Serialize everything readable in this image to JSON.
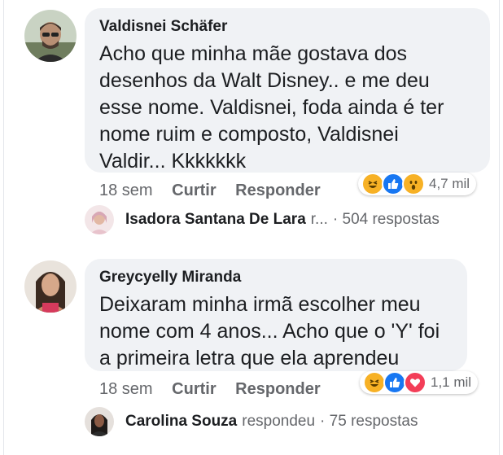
{
  "comments": [
    {
      "author": "Valdisnei Schäfer",
      "text_lines": [
        "Acho que minha mãe gostava dos",
        "desenhos da Walt Disney.. e me deu",
        "esse nome. Valdisnei, foda ainda é ter",
        "nome ruim e composto, Valdisnei",
        "Valdir... Kkkkkkk"
      ],
      "time": "18 sem",
      "like_label": "Curtir",
      "reply_label": "Responder",
      "reactions": [
        "haha-icon",
        "like-icon",
        "wow-icon"
      ],
      "reaction_count": "4,7 mil",
      "reply_summary": {
        "name": "Isadora Santana De Lara",
        "action": "r...",
        "count": "· 504 respostas"
      }
    },
    {
      "author": "Greycyelly Miranda",
      "text_lines": [
        "Deixaram minha irmã escolher meu",
        "nome com 4 anos... Acho que o 'Y' foi",
        "a primeira letra que ela aprendeu"
      ],
      "time": "18 sem",
      "like_label": "Curtir",
      "reply_label": "Responder",
      "reactions": [
        "haha-icon",
        "like-icon",
        "love-icon"
      ],
      "reaction_count": "1,1 mil",
      "reply_summary": {
        "name": "Carolina Souza",
        "action": "respondeu",
        "count": "· 75 respostas"
      }
    }
  ],
  "colors": {
    "bubble": "#f0f2f5",
    "secondary_text": "#65676b",
    "like_blue": "#1877f2",
    "haha_yellow": "#f7b125",
    "love_red": "#f33e58"
  }
}
